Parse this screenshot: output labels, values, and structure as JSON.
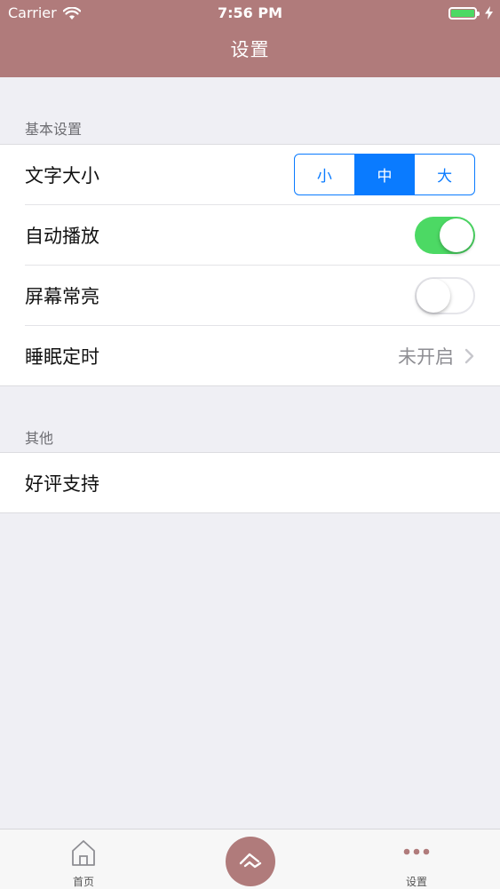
{
  "status_bar": {
    "carrier": "Carrier",
    "time": "7:56 PM"
  },
  "nav": {
    "title": "设置"
  },
  "sections": [
    {
      "header": "基本设置",
      "rows": [
        {
          "label": "文字大小",
          "segments": [
            "小",
            "中",
            "大"
          ],
          "selected": "中"
        },
        {
          "label": "自动播放",
          "toggle": true
        },
        {
          "label": "屏幕常亮",
          "toggle": false
        },
        {
          "label": "睡眠定时",
          "value": "未开启"
        }
      ]
    },
    {
      "header": "其他",
      "rows": [
        {
          "label": "好评支持"
        }
      ]
    }
  ],
  "tabbar": {
    "home_label": "首页",
    "settings_label": "设置"
  },
  "colors": {
    "brand": "#b07b7b",
    "accent": "#0a7bff",
    "switch_on": "#4cd964",
    "battery": "#4cd964"
  },
  "icons": {
    "wifi": "wifi-icon",
    "battery": "battery-icon",
    "charging": "charging-bolt-icon",
    "chevron": "chevron-right-icon",
    "home": "home-icon",
    "center": "player-logo-icon",
    "more": "more-dots-icon"
  }
}
